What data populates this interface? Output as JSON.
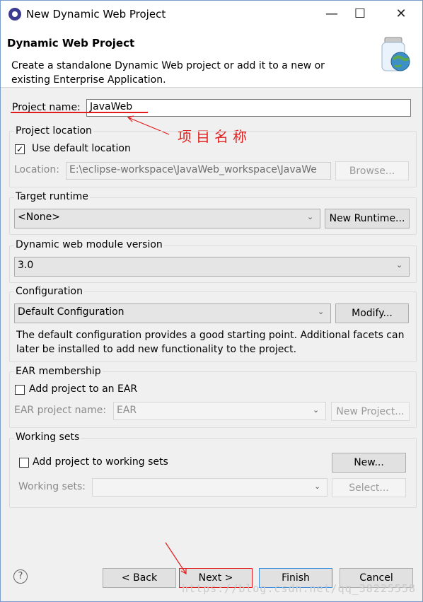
{
  "window": {
    "title": "New Dynamic Web Project",
    "minimize": "—",
    "maximize": "☐",
    "close": "✕"
  },
  "header": {
    "title": "Dynamic Web Project",
    "description": "Create a standalone Dynamic Web project or add it to a new or existing Enterprise Application."
  },
  "project_name": {
    "label": "Project name:",
    "value": "JavaWeb"
  },
  "annotation": {
    "text": "项目名称",
    "color": "#e21c1c"
  },
  "project_location": {
    "title": "Project location",
    "use_default_label": "Use default location",
    "use_default_checked": "✓",
    "location_label": "Location:",
    "location_value": "E:\\eclipse-workspace\\JavaWeb_workspace\\JavaWe",
    "browse_label": "Browse..."
  },
  "target_runtime": {
    "title": "Target runtime",
    "selected": "<None>",
    "new_runtime_label": "New Runtime..."
  },
  "module_version": {
    "title": "Dynamic web module version",
    "selected": "3.0"
  },
  "configuration": {
    "title": "Configuration",
    "selected": "Default Configuration",
    "modify_label": "Modify...",
    "description": "The default configuration provides a good starting point. Additional facets can later be installed to add new functionality to the project."
  },
  "ear": {
    "title": "EAR membership",
    "add_label": "Add project to an EAR",
    "name_label": "EAR project name:",
    "name_value": "EAR",
    "new_project_label": "New Project..."
  },
  "working_sets": {
    "title": "Working sets",
    "add_label": "Add project to working sets",
    "new_label": "New...",
    "sets_label": "Working sets:",
    "select_label": "Select..."
  },
  "footer": {
    "help_icon": "?",
    "back_label": "< Back",
    "next_label": "Next >",
    "finish_label": "Finish",
    "cancel_label": "Cancel",
    "watermark": "https://blog.csdn.net/qq_38225558"
  },
  "icons": {
    "app": "eclipse-icon",
    "header": "web-project-jar-icon",
    "chevron": "chevron-down-icon",
    "help": "help-icon"
  }
}
